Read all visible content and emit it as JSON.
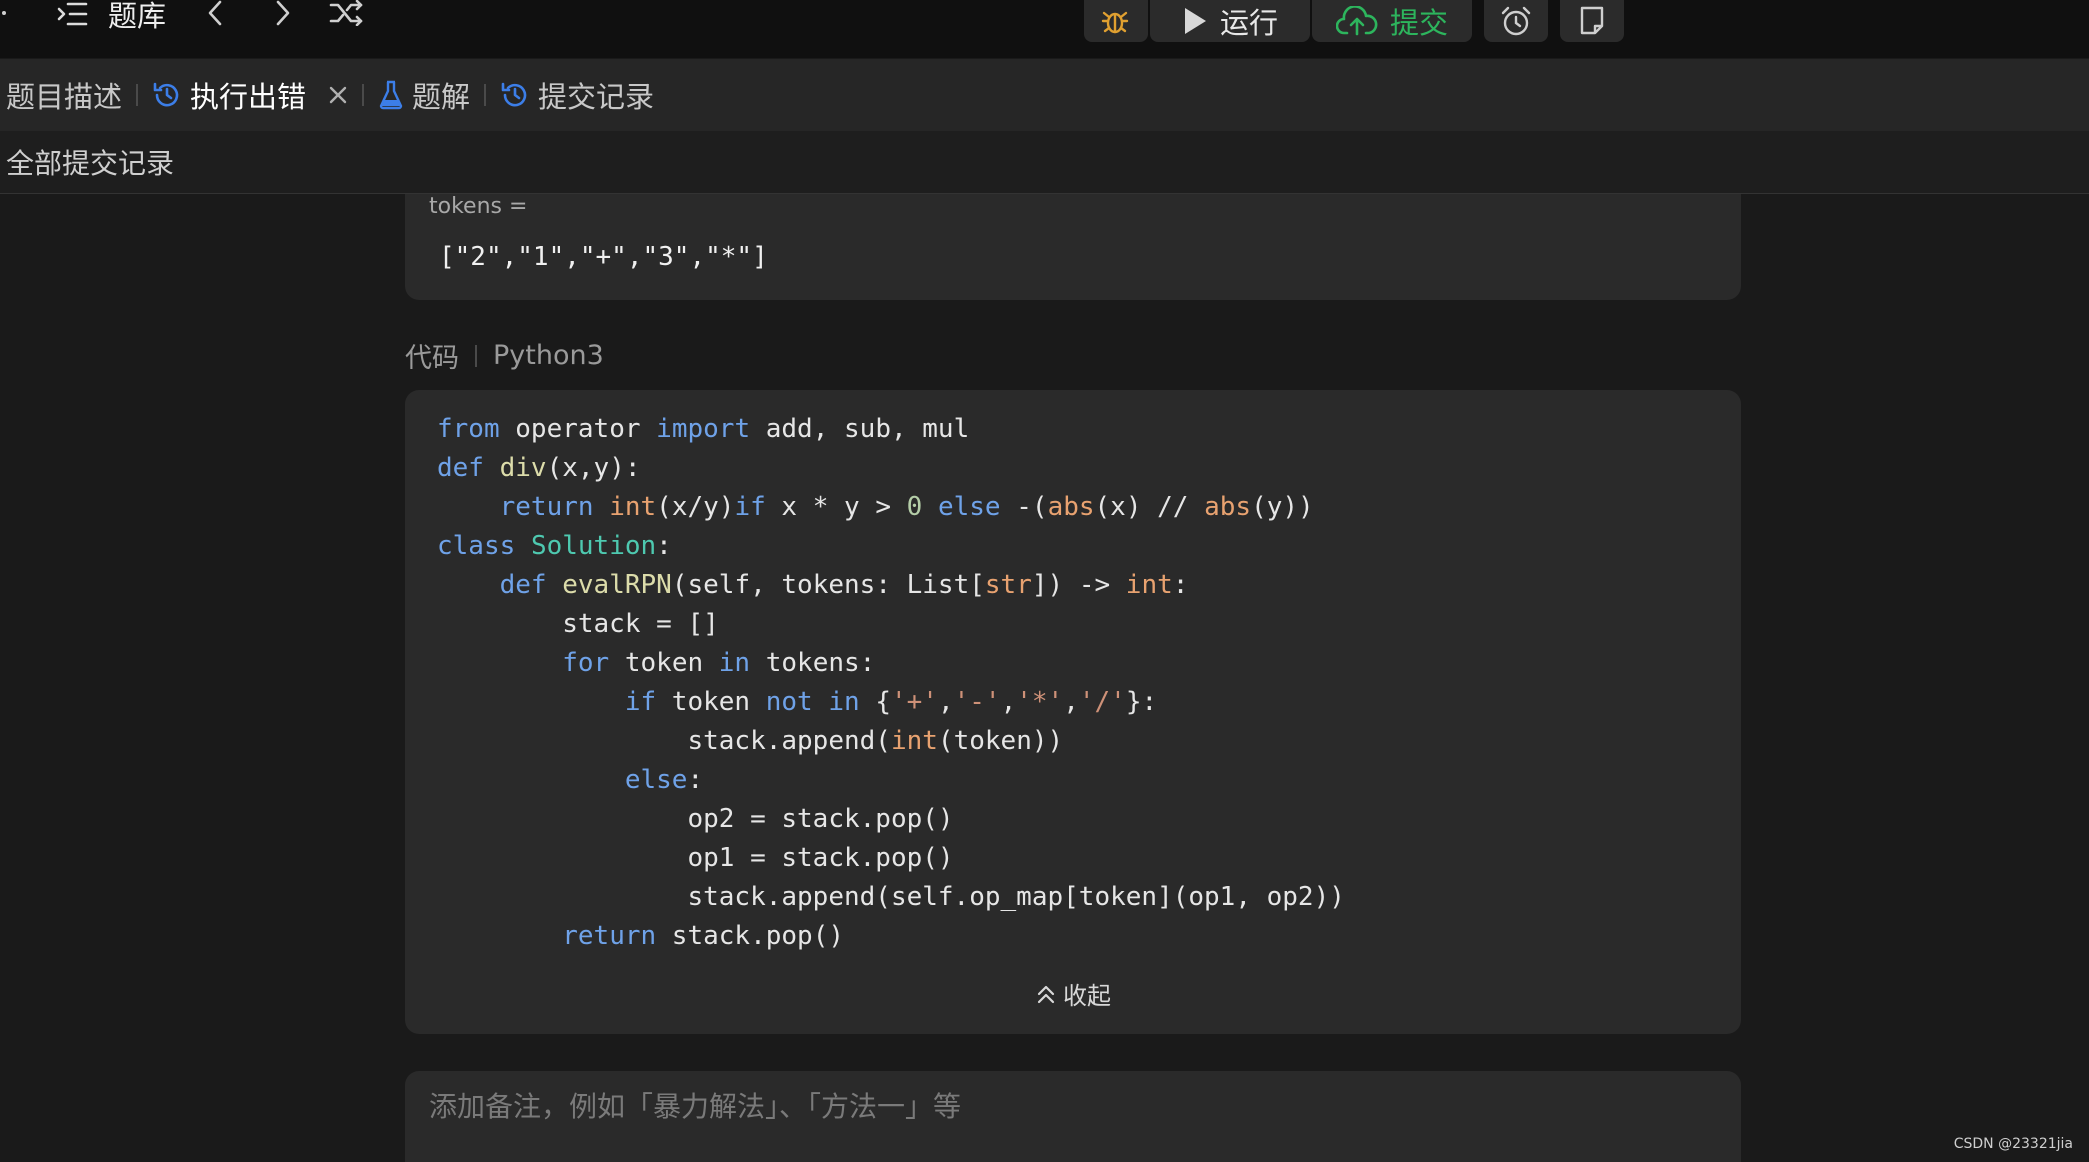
{
  "topbar": {
    "problem_bank_label": "题库",
    "run_label": "运行",
    "submit_label": "提交"
  },
  "tabs": [
    {
      "label": "题目描述"
    },
    {
      "label": "执行出错"
    },
    {
      "label": "题解"
    },
    {
      "label": "提交记录"
    }
  ],
  "subheader": {
    "title": "全部提交记录"
  },
  "input": {
    "label": "tokens =",
    "value": "[\"2\",\"1\",\"+\",\"3\",\"*\"]"
  },
  "code_section": {
    "title": "代码",
    "language": "Python3",
    "lines": [
      [
        {
          "t": "from",
          "c": "kw"
        },
        {
          "t": " operator "
        },
        {
          "t": "import",
          "c": "kw"
        },
        {
          "t": " add, sub, mul"
        }
      ],
      [
        {
          "t": "def",
          "c": "kw"
        },
        {
          "t": " "
        },
        {
          "t": "div",
          "c": "fn"
        },
        {
          "t": "(x,y):"
        }
      ],
      [
        {
          "t": "    "
        },
        {
          "t": "return",
          "c": "kw"
        },
        {
          "t": " "
        },
        {
          "t": "int",
          "c": "bi"
        },
        {
          "t": "(x/y)"
        },
        {
          "t": "if",
          "c": "kw"
        },
        {
          "t": " x * y > "
        },
        {
          "t": "0",
          "c": "num"
        },
        {
          "t": " "
        },
        {
          "t": "else",
          "c": "kw"
        },
        {
          "t": " -("
        },
        {
          "t": "abs",
          "c": "bi"
        },
        {
          "t": "(x) // "
        },
        {
          "t": "abs",
          "c": "bi"
        },
        {
          "t": "(y))"
        }
      ],
      [
        {
          "t": "class",
          "c": "kw"
        },
        {
          "t": " "
        },
        {
          "t": "Solution",
          "c": "cls"
        },
        {
          "t": ":"
        }
      ],
      [
        {
          "t": "    "
        },
        {
          "t": "def",
          "c": "kw"
        },
        {
          "t": " "
        },
        {
          "t": "evalRPN",
          "c": "fn"
        },
        {
          "t": "(self, tokens: List["
        },
        {
          "t": "str",
          "c": "bi"
        },
        {
          "t": "]) -> "
        },
        {
          "t": "int",
          "c": "bi"
        },
        {
          "t": ":"
        }
      ],
      [
        {
          "t": "        stack = []"
        }
      ],
      [
        {
          "t": "        "
        },
        {
          "t": "for",
          "c": "kw"
        },
        {
          "t": " token "
        },
        {
          "t": "in",
          "c": "kw"
        },
        {
          "t": " tokens:"
        }
      ],
      [
        {
          "t": "            "
        },
        {
          "t": "if",
          "c": "kw"
        },
        {
          "t": " token "
        },
        {
          "t": "not",
          "c": "kw"
        },
        {
          "t": " "
        },
        {
          "t": "in",
          "c": "kw"
        },
        {
          "t": " {"
        },
        {
          "t": "'+'",
          "c": "str"
        },
        {
          "t": ","
        },
        {
          "t": "'-'",
          "c": "str"
        },
        {
          "t": ","
        },
        {
          "t": "'*'",
          "c": "str"
        },
        {
          "t": ","
        },
        {
          "t": "'/'",
          "c": "str"
        },
        {
          "t": "}:"
        }
      ],
      [
        {
          "t": "                stack.append("
        },
        {
          "t": "int",
          "c": "bi"
        },
        {
          "t": "(token))"
        }
      ],
      [
        {
          "t": "            "
        },
        {
          "t": "else",
          "c": "kw"
        },
        {
          "t": ":"
        }
      ],
      [
        {
          "t": "                op2 = stack.pop()"
        }
      ],
      [
        {
          "t": "                op1 = stack.pop()"
        }
      ],
      [
        {
          "t": "                stack.append(self.op_map[token](op1, op2))"
        }
      ],
      [
        {
          "t": "        "
        },
        {
          "t": "return",
          "c": "kw"
        },
        {
          "t": " stack.pop()"
        }
      ]
    ],
    "collapse_label": "收起"
  },
  "note": {
    "placeholder": "添加备注，例如「暴力解法」、「方法一」等"
  },
  "watermark": "CSDN @23321jia",
  "colors": {
    "accent_blue": "#3c7ee8",
    "submit_green": "#2db55d",
    "keyword": "#6fa2e8",
    "function": "#dcdcaa",
    "builtin": "#e8a270",
    "class": "#4ec9b0",
    "number": "#b5cea8",
    "string": "#ce9178"
  },
  "icons": {
    "problem_list": "list-indent-icon",
    "prev": "chevron-left-icon",
    "next": "chevron-right-icon",
    "random": "shuffle-icon",
    "debug": "bug-icon",
    "run": "play-icon",
    "submit": "cloud-upload-icon",
    "alarm": "alarm-clock-icon",
    "notes": "note-icon",
    "error_tab": "history-icon",
    "solution_tab": "flask-icon",
    "submissions_tab": "history-icon",
    "close": "close-icon",
    "collapse": "double-chevron-up-icon"
  }
}
